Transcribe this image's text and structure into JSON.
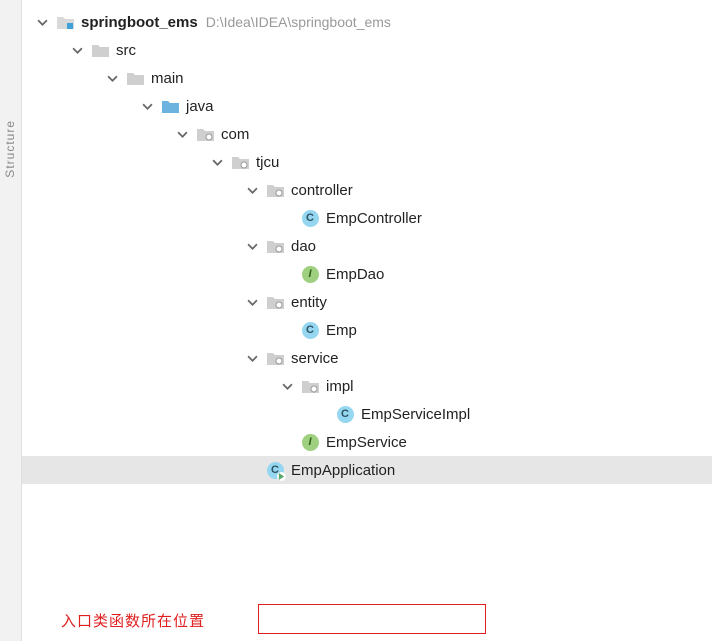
{
  "sidebar": {
    "label": "Structure"
  },
  "tree": {
    "root": {
      "name": "springboot_ems",
      "path": "D:\\Idea\\IDEA\\springboot_ems"
    },
    "src": {
      "name": "src"
    },
    "main": {
      "name": "main"
    },
    "java": {
      "name": "java"
    },
    "com": {
      "name": "com"
    },
    "tjcu": {
      "name": "tjcu"
    },
    "controller": {
      "name": "controller"
    },
    "empController": {
      "name": "EmpController",
      "kind": "C"
    },
    "dao": {
      "name": "dao"
    },
    "empDao": {
      "name": "EmpDao",
      "kind": "I"
    },
    "entity": {
      "name": "entity"
    },
    "emp": {
      "name": "Emp",
      "kind": "C"
    },
    "service": {
      "name": "service"
    },
    "impl": {
      "name": "impl"
    },
    "empServiceImpl": {
      "name": "EmpServiceImpl",
      "kind": "C"
    },
    "empService": {
      "name": "EmpService",
      "kind": "I"
    },
    "empApplication": {
      "name": "EmpApplication",
      "kind": "C"
    }
  },
  "annotation": {
    "text": "入口类函数所在位置"
  }
}
